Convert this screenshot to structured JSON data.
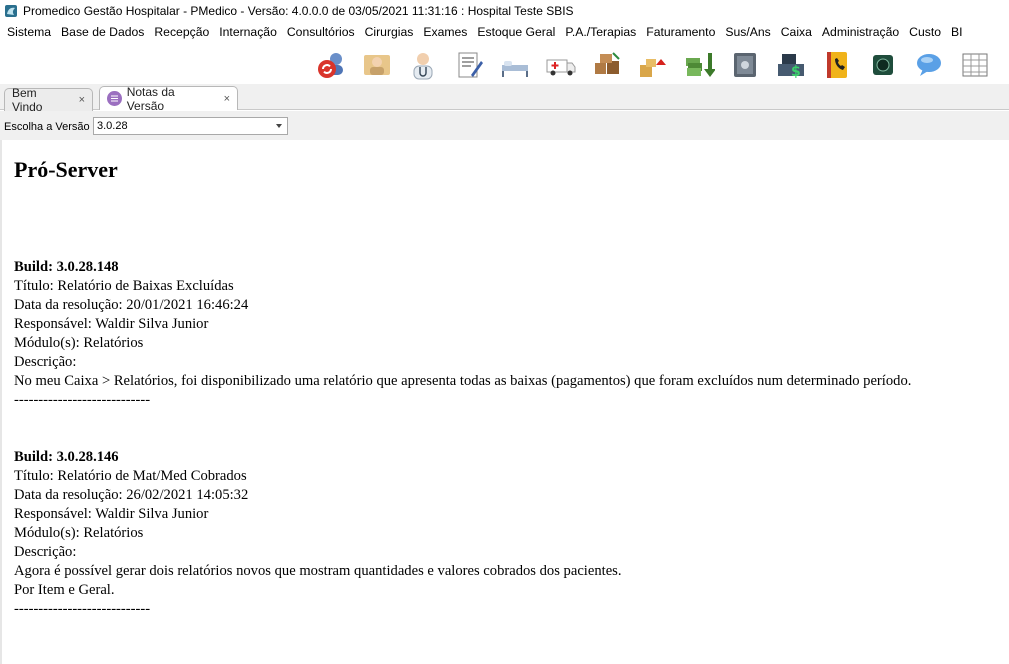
{
  "window": {
    "title": "Promedico Gestão Hospitalar - PMedico - Versão: 4.0.0.0 de 03/05/2021 11:31:16 : Hospital Teste SBIS"
  },
  "menu": [
    {
      "label": "Sistema"
    },
    {
      "label": "Base de Dados"
    },
    {
      "label": "Recepção"
    },
    {
      "label": "Internação"
    },
    {
      "label": "Consultórios"
    },
    {
      "label": "Cirurgias"
    },
    {
      "label": "Exames"
    },
    {
      "label": "Estoque Geral"
    },
    {
      "label": "P.A./Terapias"
    },
    {
      "label": "Faturamento"
    },
    {
      "label": "Sus/Ans"
    },
    {
      "label": "Caixa"
    },
    {
      "label": "Administração"
    },
    {
      "label": "Custo"
    },
    {
      "label": "BI"
    }
  ],
  "toolbar_icons": [
    "refresh-users-icon",
    "reception-icon",
    "doctor-icon",
    "prescription-icon",
    "hospital-bed-icon",
    "ambulance-icon",
    "stock-boxes-icon",
    "stock-up-icon",
    "money-down-icon",
    "safe-icon",
    "cash-register-icon",
    "phone-book-icon",
    "camera-icon",
    "chat-icon",
    "report-grid-icon"
  ],
  "tabs": [
    {
      "label": "Bem Vindo",
      "close": "×"
    },
    {
      "label": "Notas da Versão",
      "close": "×"
    }
  ],
  "filter": {
    "label": "Escolha a Versão",
    "selected_version": "3.0.28"
  },
  "release_notes": {
    "heading": "Pró-Server",
    "entries": [
      {
        "build": "Build: 3.0.28.148",
        "titulo": "Título: Relatório de Baixas Excluídas",
        "data": "Data da resolução: 20/01/2021 16:46:24",
        "responsavel": "Responsável: Waldir Silva Junior",
        "modulos": "Módulo(s): Relatórios",
        "descricao_label": "Descrição:",
        "descricao": [
          "No meu Caixa > Relatórios, foi disponibilizado uma relatório que apresenta todas as baixas (pagamentos) que foram excluídos num determinado período."
        ],
        "separator": "----------------------------"
      },
      {
        "build": "Build: 3.0.28.146",
        "titulo": "Título: Relatório de Mat/Med Cobrados",
        "data": "Data da resolução: 26/02/2021 14:05:32",
        "responsavel": "Responsável: Waldir Silva Junior",
        "modulos": "Módulo(s): Relatórios",
        "descricao_label": "Descrição:",
        "descricao": [
          "Agora é possível gerar dois relatórios novos que mostram quantidades e valores cobrados dos pacientes.",
          "Por Item e Geral."
        ],
        "separator": "----------------------------"
      }
    ]
  }
}
